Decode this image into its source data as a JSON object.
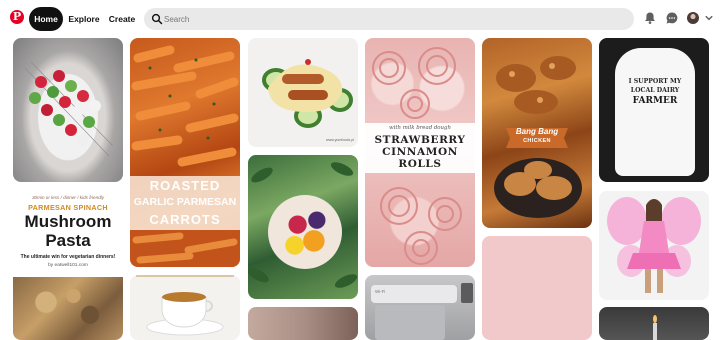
{
  "header": {
    "logo_glyph": "P",
    "nav": {
      "home": "Home",
      "explore": "Explore",
      "create": "Create"
    },
    "search_placeholder": "Search",
    "icons": [
      "pinterest-logo-icon",
      "search-icon",
      "bell-icon",
      "chat-icon",
      "avatar",
      "chevron-down-icon"
    ]
  },
  "pins": {
    "pasta": {
      "tagline": "30min or less / dinner / kids friendly",
      "subtitle": "PARMESAN SPINACH",
      "title_1": "Mushroom",
      "title_2": "Pasta",
      "desc": "The ultimate win for vegetarian dinners!",
      "credit": "by eatwell101.com"
    },
    "carrots": {
      "line_1": "ROASTED",
      "line_2": "GARLIC PARMESAN",
      "line_3": "CARROTS"
    },
    "cucumber": {
      "credit": "www.yumfoods.pl"
    },
    "rolls": {
      "script": "with milk bread dough",
      "line_1": "STRAWBERRY",
      "line_2": "CINNAMON",
      "line_3": "ROLLS"
    },
    "chicken": {
      "line_1": "Bang Bang",
      "line_2": "CHICKEN"
    },
    "onesie": {
      "line_1": "I SUPPORT MY",
      "line_2": "LOCAL DAIRY",
      "line_3": "FARMER"
    },
    "mixer": {
      "brand": "Wi-Fi"
    }
  },
  "colors": {
    "brand": "#e60023",
    "home_bg": "#111111",
    "search_bg": "#e9e9e9"
  }
}
